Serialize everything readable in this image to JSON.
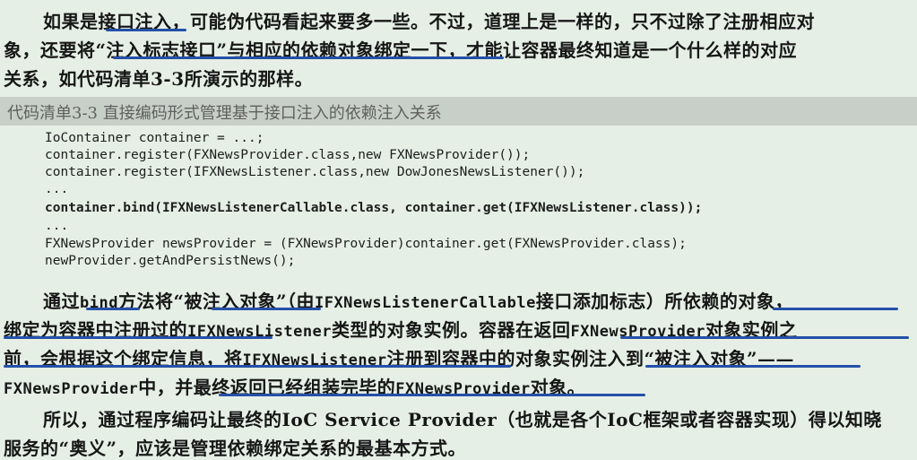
{
  "para1": {
    "line1": "如果是接口注入，可能伪代码看起来要多一些。不过，道理上是一样的，只不过除了注册相应对",
    "line2": "象，还要将“注入标志接口”与相应的依赖对象绑定一下，才能让容器最终知道是一个什么样的对应",
    "line3": "关系，如代码清单3-3所演示的那样。"
  },
  "listing": {
    "title": "代码清单3-3   直接编码形式管理基于接口注入的依赖注入关系",
    "code": [
      "IoContainer container = ...;",
      "container.register(FXNewsProvider.class,new FXNewsProvider());",
      "container.register(IFXNewsListener.class,new DowJonesNewsListener());",
      "...",
      "container.bind(IFXNewsListenerCallable.class, container.get(IFXNewsListener.class));",
      "...",
      "FXNewsProvider newsProvider = (FXNewsProvider)container.get(FXNewsProvider.class);",
      "newProvider.getAndPersistNews();"
    ]
  },
  "para2": {
    "l1a": "通过",
    "l1b": "bind",
    "l1c": "方法将“被注入对象”（由",
    "l1d": "IFXNewsListenerCallable",
    "l1e": "接口添加标志）所依赖的对象，",
    "l2a": "绑定为容器中注册过的",
    "l2b": "IFXNewsListener",
    "l2c": "类型的对象实例。容器在返回",
    "l2d": "FXNewsProvider",
    "l2e": "对象实例之",
    "l3a": "前，会根据这个绑定信息，将",
    "l3b": "IFXNewsListener",
    "l3c": "注册到容器中的对象实例注入到“被注入对象”——",
    "l4a": "FXNewsProvider",
    "l4b": "中，并最终返回已经组装完毕的",
    "l4c": "FXNewsProvider",
    "l4d": "对象。"
  },
  "para3": {
    "line1": "所以，通过程序编码让最终的IoC Service Provider（也就是各个IoC框架或者容器实现）得以知晓",
    "line2": "服务的“奥义”，应该是管理依赖绑定关系的最基本方式。"
  },
  "colors": {
    "underline": "#2550a8",
    "background": "#e5efe6",
    "listing_bar": "#c8cfc8"
  }
}
